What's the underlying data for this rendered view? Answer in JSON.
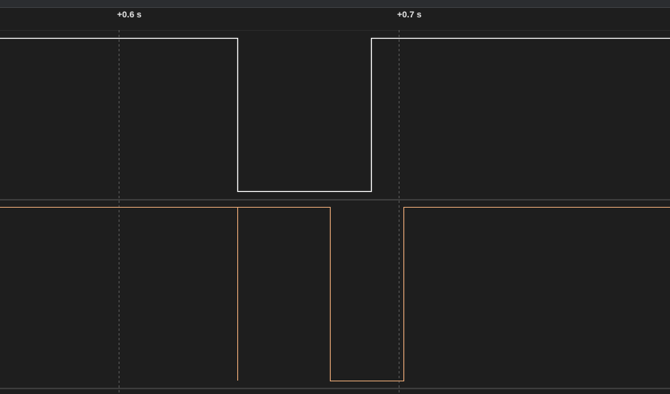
{
  "timeline": {
    "tick_labels": [
      "+0.6 s",
      "+0.7 s"
    ]
  },
  "channels": [
    {
      "color": "#ffffff",
      "name": ""
    },
    {
      "color": "#e8a876",
      "name": ""
    }
  ],
  "colors": {
    "background": "#1e1e1e",
    "grid": "#5a5a5a",
    "separator": "#3c3c3c"
  }
}
